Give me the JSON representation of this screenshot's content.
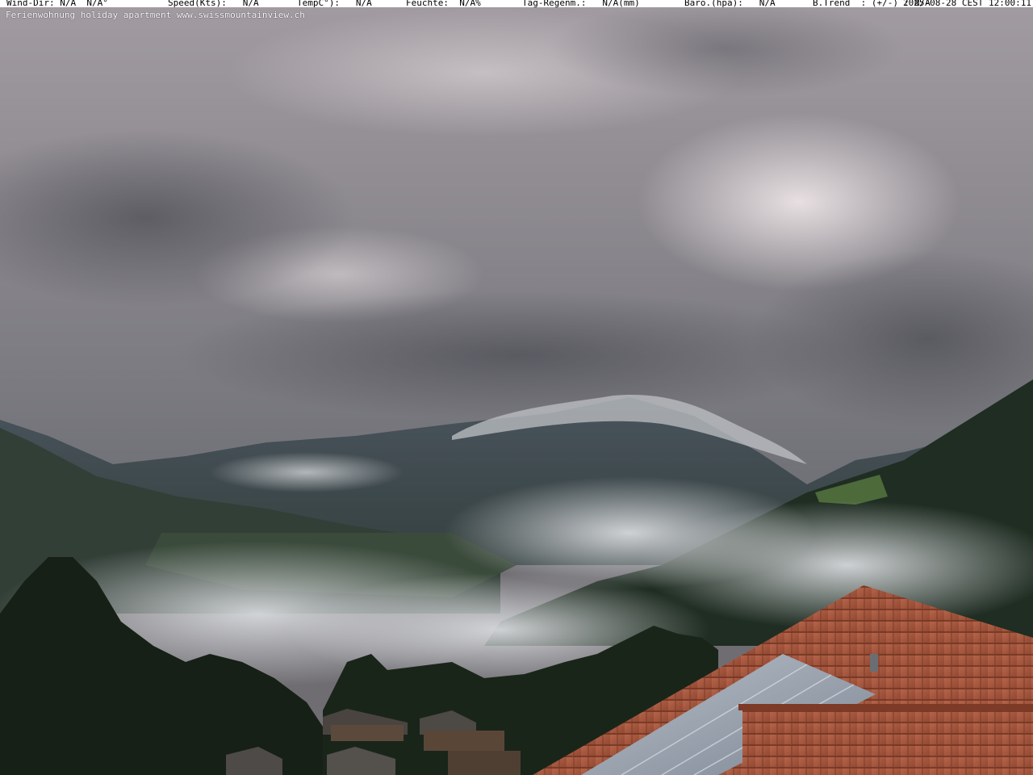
{
  "overlay": {
    "status": {
      "wind": "Wind-Dir: N/A  N/A°",
      "speed": "Speed(Kts):   N/A",
      "temp": "TempC°):   N/A",
      "humidity": "Feuchte:  N/A%",
      "rain": "Tag-Regenm.:   N/A(mm)",
      "baro": "Baro.(hpa):   N/A",
      "trend": "B.Trend  : (+/-) : N/A",
      "timestamp": "2025-08-28 CEST 12:00:11"
    },
    "caption": "Ferienwohnung holiday apartment www.swissmountainview.ch"
  },
  "scene": {
    "subject": "webcam view over cloud-covered alpine valley with lake, forested slopes, chalets and tiled roof in foreground",
    "colors": {
      "sky_top": "#8e8a92",
      "sky_bright": "#cfc7cc",
      "cloud_dark": "#5f6066",
      "mountain": "#3f4a52",
      "valley": "#2e3a33",
      "fog": "#c9ccd0",
      "forest": "#1c2a1c",
      "roof": "#a5533a",
      "solar_panel": "#9aa4b2"
    }
  }
}
